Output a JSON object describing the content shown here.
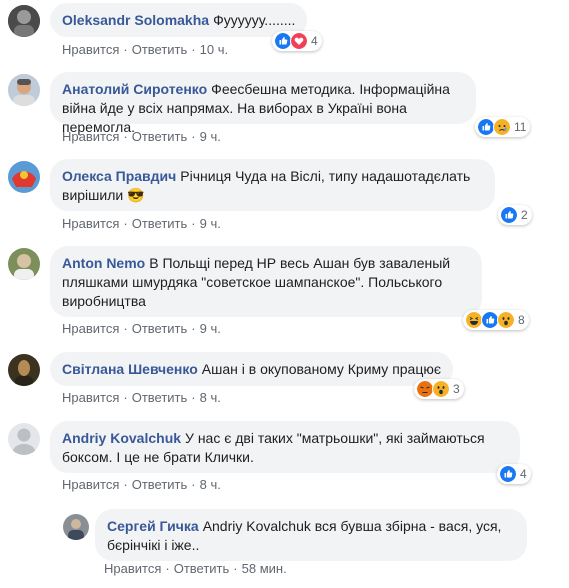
{
  "comments": [
    {
      "author": "Oleksandr Solomakha",
      "text": "Фуууууу........",
      "like": "Нравится",
      "reply": "Ответить",
      "time": "10 ч.",
      "reactions": [
        "like",
        "love"
      ],
      "count": "4"
    },
    {
      "author": "Анатолий Сиротенко",
      "text": "Феесбешна методика. Інформаційна війна йде у всіх напрямах. На виборах в Україні вона перемогла.",
      "like": "Нравится",
      "reply": "Ответить",
      "time": "9 ч.",
      "reactions": [
        "like",
        "sad"
      ],
      "count": "11"
    },
    {
      "author": "Олекса Правдич",
      "text": "Річниця Чуда на Віслі, типу надашотадєлать вирішили 😎",
      "like": "Нравится",
      "reply": "Ответить",
      "time": "9 ч.",
      "reactions": [
        "like"
      ],
      "count": "2"
    },
    {
      "author": "Anton Nemo",
      "text": "В Польщі перед НР весь Ашан був заваленый пляшками шмурдяка \"советское шампанское\". Польського виробництва",
      "like": "Нравится",
      "reply": "Ответить",
      "time": "9 ч.",
      "reactions": [
        "haha",
        "like",
        "wow"
      ],
      "count": "8"
    },
    {
      "author": "Світлана Шевченко",
      "text": "Ашан і в окупованому Криму працює",
      "like": "Нравится",
      "reply": "Ответить",
      "time": "8 ч.",
      "reactions": [
        "angry",
        "wow"
      ],
      "count": "3"
    },
    {
      "author": "Andriy Kovalchuk",
      "text": "У нас є дві таких \"матрьошки\", які займаються боксом. І це не брати Клички.",
      "like": "Нравится",
      "reply": "Ответить",
      "time": "8 ч.",
      "reactions": [
        "like"
      ],
      "count": "4"
    }
  ],
  "reply": {
    "author": "Сергей Гичка",
    "text": "Andriy Kovalchuk вся бувша збірна - вася, уся, бєрінчікі і іже..",
    "like": "Нравится",
    "reply": "Ответить",
    "time": "58 мин."
  },
  "colors": {
    "author": "#385898",
    "bubble": "#f2f3f5",
    "meta": "#616770",
    "like": "#1877f2",
    "love": "#f33e58",
    "sad": "#f7b125",
    "angry": "#e9710f"
  }
}
